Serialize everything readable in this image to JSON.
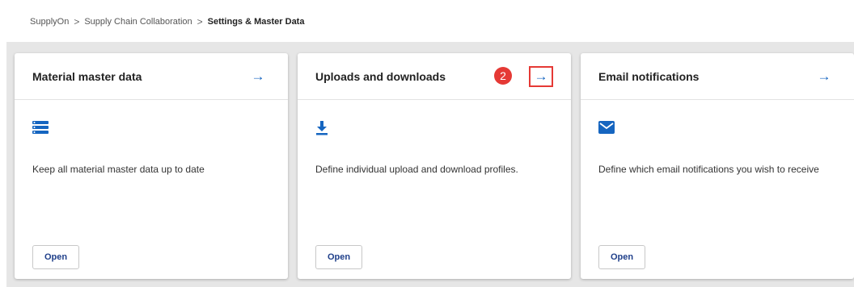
{
  "breadcrumb": {
    "items": [
      "SupplyOn",
      "Supply Chain Collaboration",
      "Settings & Master Data"
    ],
    "separator": ">"
  },
  "cards": [
    {
      "title": "Material master data",
      "arrow": "→",
      "icon": "list-icon",
      "description": "Keep all material master data up to date",
      "button": "Open"
    },
    {
      "title": "Uploads and downloads",
      "arrow": "→",
      "icon": "download-icon",
      "description": "Define individual upload and download profiles.",
      "button": "Open",
      "step_badge": "2"
    },
    {
      "title": "Email notifications",
      "arrow": "→",
      "icon": "mail-icon",
      "description": "Define which email notifications you wish to receive",
      "button": "Open"
    }
  ],
  "colors": {
    "accent": "#1565c0",
    "highlight": "#e53935",
    "panel_background": "#e6e6e6"
  }
}
